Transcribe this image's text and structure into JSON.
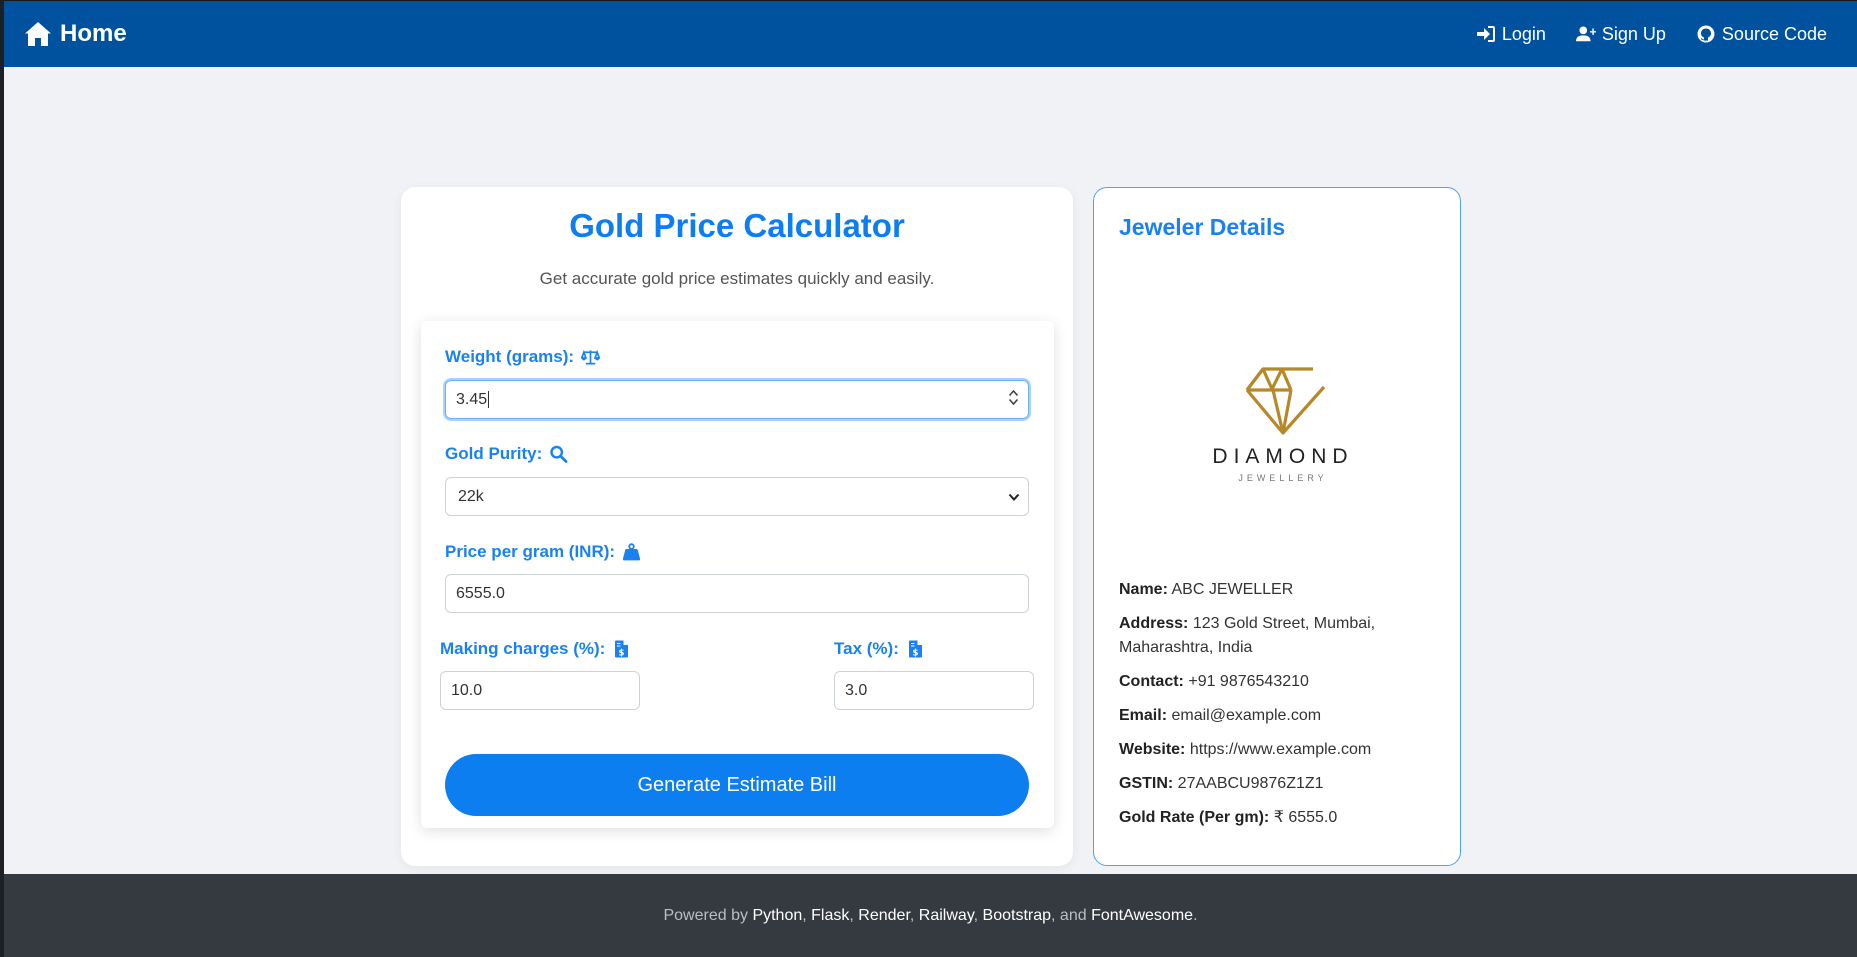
{
  "navbar": {
    "brand": "Home",
    "links": [
      {
        "label": "Login",
        "icon": "login-icon"
      },
      {
        "label": "Sign Up",
        "icon": "user-plus-icon"
      },
      {
        "label": "Source Code",
        "icon": "github-icon"
      }
    ]
  },
  "calculator": {
    "title": "Gold Price Calculator",
    "subtitle": "Get accurate gold price estimates quickly and easily.",
    "weight": {
      "label": "Weight (grams):",
      "icon": "scale-icon",
      "value": "3.45"
    },
    "purity": {
      "label": "Gold Purity:",
      "icon": "search-icon",
      "selected": "22k"
    },
    "price": {
      "label": "Price per gram (INR):",
      "icon": "weight-bag-icon",
      "value": "6555.0"
    },
    "making": {
      "label": "Making charges (%):",
      "icon": "invoice-icon",
      "value": "10.0"
    },
    "tax": {
      "label": "Tax (%):",
      "icon": "invoice-icon",
      "value": "3.0"
    },
    "submit_label": "Generate Estimate Bill"
  },
  "jeweler": {
    "title": "Jeweler Details",
    "logo": {
      "name": "DIAMOND",
      "tagline": "JEWELLERY",
      "color": "#b5892a"
    },
    "details": [
      {
        "key": "Name:",
        "value": "ABC JEWELLER"
      },
      {
        "key": "Address:",
        "value": "123 Gold Street, Mumbai, Maharashtra, India"
      },
      {
        "key": "Contact:",
        "value": "+91 9876543210"
      },
      {
        "key": "Email:",
        "value": "email@example.com"
      },
      {
        "key": "Website:",
        "value": "https://www.example.com"
      },
      {
        "key": "GSTIN:",
        "value": "27AABCU9876Z1Z1"
      },
      {
        "key": "Gold Rate (Per gm):",
        "value": "₹ 6555.0"
      }
    ]
  },
  "footer": {
    "prefix": "Powered by",
    "techs": [
      "Python",
      "Flask",
      "Render",
      "Railway",
      "Bootstrap",
      "FontAwesome"
    ],
    "sep": ",",
    "and": "and",
    "end": "."
  },
  "colors": {
    "navbar": "#00519e",
    "accent": "#0d7ef0",
    "footer": "#343a40"
  }
}
